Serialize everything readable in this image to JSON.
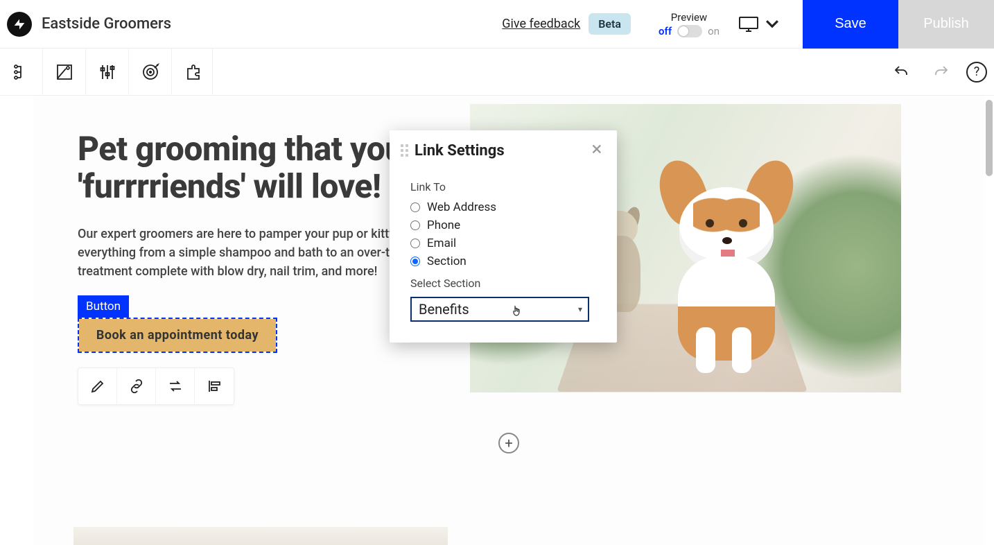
{
  "header": {
    "title": "Eastside Groomers",
    "feedback": "Give feedback",
    "beta": "Beta",
    "preview_label": "Preview",
    "off": "off",
    "on": "on",
    "save": "Save",
    "publish": "Publish"
  },
  "hero": {
    "headline": "Pet grooming that your 'furrrriends' will love!",
    "body": "Our expert groomers are here to pamper your pup or kitty with everything from a simple shampoo and bath to an over-the-top spa treatment complete with blow dry, nail trim, and more!",
    "cta": "Book an appointment today",
    "selection_tag": "Button"
  },
  "link_settings": {
    "title": "Link Settings",
    "link_to_label": "Link To",
    "options": {
      "web": "Web Address",
      "phone": "Phone",
      "email": "Email",
      "section": "Section"
    },
    "selected": "section",
    "select_section_label": "Select Section",
    "section_value": "Benefits"
  },
  "icons": {
    "logo": "unbounce-logo",
    "tools": [
      "structure-icon",
      "style-icon",
      "sliders-icon",
      "target-icon",
      "puzzle-icon"
    ],
    "undo": "undo-icon",
    "redo": "redo-icon",
    "help": "?"
  },
  "colors": {
    "primary": "#0033ff",
    "cta_bg": "#e3b66b",
    "beta_bg": "#c9e6f0"
  }
}
